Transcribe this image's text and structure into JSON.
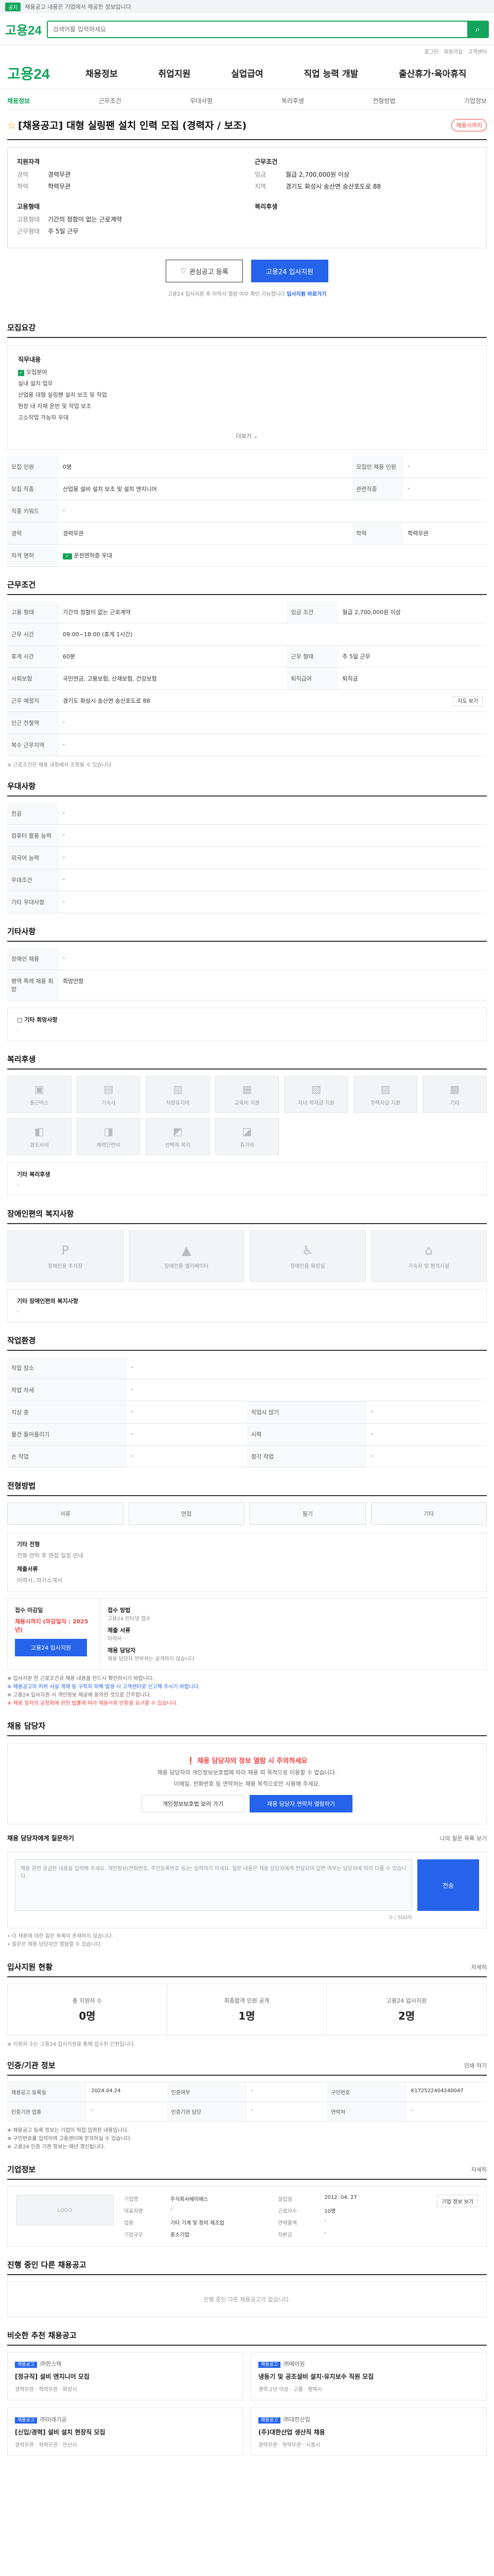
{
  "notice": {
    "tag": "공지",
    "text": "채용공고 내용은 기업에서 제공한 정보입니다"
  },
  "top": {
    "logo": "고용24",
    "search_placeholder": "검색어를 입력하세요"
  },
  "util": [
    "로그인",
    "회원가입",
    "고객센터"
  ],
  "gnb": {
    "logo": "고용24",
    "menu": [
      "채용정보",
      "취업지원",
      "실업급여",
      "직업 능력 개발",
      "출산휴가·육아휴직"
    ]
  },
  "sub_tabs": [
    "채용정보",
    "근무조건",
    "우대사항",
    "복리후생",
    "전형방법",
    "기업정보"
  ],
  "job": {
    "title": "[채용공고] 대형 실링팬 설치 인력 모집 (경력자 / 보조)",
    "pill": "채용시까지"
  },
  "summary": {
    "left_title": "지원자격",
    "left": [
      {
        "k": "경력",
        "v": "경력무관"
      },
      {
        "k": "학력",
        "v": "학력무관"
      }
    ],
    "emp_title": "고용형태",
    "emp": [
      {
        "k": "고용형태",
        "v": "기간의 정함이 없는 근로계약"
      },
      {
        "k": "근무형태",
        "v": "주 5일 근무"
      }
    ],
    "right_title": "근무조건",
    "right": [
      {
        "k": "임금",
        "v": "월급 2,700,000원 이상"
      },
      {
        "k": "지역",
        "v": "경기도 화성시 송산면 송산포도로 88"
      }
    ],
    "welfare_title": "복리후생"
  },
  "actions": {
    "scrap": "관심공고 등록",
    "apply": "고용24 입사지원"
  },
  "caution": {
    "text": "고용24 입사지원 후 이력서 열람 여부 확인 가능합니다",
    "link": "입사지원 바로가기"
  },
  "duty": {
    "head": "모집요강",
    "job_title": "직무내용",
    "checkbox": "모집분야",
    "lines": [
      "실내 설치 업무",
      "산업용 대형 실링팬 설치 보조 및 작업",
      "현장 내 자재 운반 및 작업 보조",
      "고소작업 가능자 우대"
    ],
    "more": "더보기"
  },
  "recruit_table": [
    {
      "k1": "모집 인원",
      "v1": "0명",
      "k2": "모집인 채용 인원",
      "v2": "-"
    },
    {
      "k1": "모집 직종",
      "v1": "산업용 설비 설치 보조 및 설치 엔지니어",
      "k2": "관련직종",
      "v2": "-"
    },
    {
      "k1": "직종 키워드",
      "v1": "-",
      "k2": "",
      "v2": ""
    },
    {
      "k1": "경력",
      "v1": "경력무관",
      "k2": "학력",
      "v2": "학력무관"
    },
    {
      "k1": "자격 면허",
      "v1": "운전면허증 우대",
      "k2": "",
      "v2": ""
    }
  ],
  "work": {
    "head": "근무조건",
    "rows": [
      {
        "k1": "고용 형태",
        "v1": "기간의 정함이 없는 근로계약",
        "k2": "임금 조건",
        "v2": "월급 2,700,000원 이상"
      },
      {
        "k1": "근무 시간",
        "v1": "09:00~18:00 (휴게 1시간)",
        "k2": "",
        "v2": ""
      },
      {
        "k1": "휴게 시간",
        "v1": "60분",
        "k2": "근무 형태",
        "v2": "주 5일 근무"
      },
      {
        "k1": "사회보험",
        "v1": "국민연금, 고용보험, 산재보험, 건강보험",
        "k2": "퇴직급여",
        "v2": "퇴직금"
      },
      {
        "k1": "근무 예정지",
        "v1": "경기도 화성시 송산면 송산포도로 88",
        "k2": "",
        "v2": ""
      },
      {
        "k1": "인근 전철역",
        "v1": "-",
        "k2": "",
        "v2": ""
      },
      {
        "k1": "복수 근무지역",
        "v1": "-",
        "k2": "",
        "v2": ""
      }
    ],
    "map_btn": "지도 보기",
    "note": "※ 근로조건은 채용 과정에서 조정될 수 있습니다"
  },
  "prefer": {
    "head": "우대사항",
    "rows": [
      {
        "k": "전공",
        "v": "-"
      },
      {
        "k": "컴퓨터 활용 능력",
        "v": "-"
      },
      {
        "k": "외국어 능력",
        "v": "-"
      },
      {
        "k": "우대조건",
        "v": "-"
      },
      {
        "k": "기타 우대사항",
        "v": "-"
      }
    ]
  },
  "etc": {
    "head": "기타사항",
    "rows": [
      {
        "k": "장애인 채용",
        "v": "-"
      },
      {
        "k": "병역 특례 채용 희망",
        "v": "희망안함"
      }
    ],
    "tag_title": "□ 기타 희망사항",
    "tag_value": "-"
  },
  "welfare": {
    "head": "복리후생",
    "icons": [
      {
        "name": "통근버스",
        "glyph": "▣"
      },
      {
        "name": "기숙사",
        "glyph": "▤"
      },
      {
        "name": "차량유지비",
        "glyph": "▥"
      },
      {
        "name": "교육비 지원",
        "glyph": "▦"
      },
      {
        "name": "자녀 학자금 지원",
        "glyph": "▧"
      },
      {
        "name": "주택자금 지원",
        "glyph": "▨"
      },
      {
        "name": "기타",
        "glyph": "▩"
      },
      {
        "name": "경조사비",
        "glyph": "◧"
      },
      {
        "name": "체력단련비",
        "glyph": "◨"
      },
      {
        "name": "선택적 복지",
        "glyph": "◩"
      },
      {
        "name": "휴가비",
        "glyph": "◪"
      }
    ],
    "tag_title": "기타 복리후생",
    "tag_value": "-"
  },
  "disabled": {
    "head": "장애인편의 복지사항",
    "cards": [
      {
        "name": "장애인용 주차장",
        "glyph": "P"
      },
      {
        "name": "장애인용 엘리베이터",
        "glyph": "▲"
      },
      {
        "name": "장애인용 화장실",
        "glyph": "♿"
      },
      {
        "name": "기숙사 및 편의시설",
        "glyph": "⌂"
      }
    ],
    "tag_title": "기타 장애인편의 복지사항",
    "tag_value": "-"
  },
  "env": {
    "head": "작업환경",
    "rows": [
      {
        "k1": "작업 장소",
        "v1": "-",
        "k2": "",
        "v2": ""
      },
      {
        "k1": "작업 자세",
        "v1": "-",
        "k2": "",
        "v2": ""
      },
      {
        "k1": "지상 층",
        "v1": "-",
        "k2": "작업시 앉기",
        "v2": "-"
      },
      {
        "k1": "물건 들어올리기",
        "v1": "-",
        "k2": "시력",
        "v2": "-"
      },
      {
        "k1": "손 작업",
        "v1": "-",
        "k2": "청각 작업",
        "v2": "-"
      }
    ]
  },
  "process": {
    "head": "전형방법",
    "steps": [
      "서류",
      "면접",
      "필기",
      "기타"
    ],
    "subtitle": "기타 전형",
    "subvalue": "전화 연락 후 면접 일정 안내",
    "doc_title": "제출서류",
    "doc_value": "이력서, 자기소개서"
  },
  "apply": {
    "l_title": "접수 마감일",
    "l_value": "채용시까지 (마감일자 : 2025년)",
    "l_btn": "고용24 입사지원",
    "r": [
      {
        "k": "접수 방법",
        "v": "고용24 인터넷 접수"
      },
      {
        "k": "제출 서류",
        "v": "이력서"
      },
      {
        "k": "채용 담당자",
        "v": "채용 담당자 연락처는 공개하지 않습니다"
      }
    ]
  },
  "warn": {
    "l1": "※ 입사지원 전 근로조건과 채용 내용을 반드시 확인하시기 바랍니다.",
    "l2": "※ 채용공고의 허위 사실 게재 등 구직자 피해 발생 시 고객센터로 신고해 주시기 바랍니다.",
    "l3": "※ 고용24 입사지원 시 개인정보 제공에 동의한 것으로 간주합니다.",
    "l4": "※ 채용 절차의 공정화에 관한 법률에 따라 채용서류 반환을 요구할 수 있습니다."
  },
  "qa": {
    "head": "채용 담당자",
    "title": "❗ 채용 담당자의 정보 열람 시 주의하세요",
    "p1": "채용 담당자의 개인정보보호법에 따라 채용 외 목적으로 이용할 수 없습니다.",
    "p2": "이메일, 전화번호 등 연락처는 채용 목적으로만 사용해 주세요.",
    "b1": "개인정보보호법 보러 가기",
    "b2": "채용 담당자 연락처 열람하기",
    "ask_title": "채용 담당자에게 질문하기",
    "ask_more": "나의 질문 목록 보기",
    "placeholder": "채용 관련 궁금한 내용을 입력해 주세요. 개인정보(전화번호, 주민등록번호 등)는 입력하지 마세요. 질문 내용은 채용 담당자에게 전달되며 답변 여부는 담당자에 따라 다를 수 있습니다.",
    "count": "0 / 500자",
    "submit": "전송",
    "foot1": "• 이 채용에 대한 질문 목록이 존재하지 않습니다.",
    "foot2": "• 질문은 채용 담당자만 열람할 수 있습니다."
  },
  "stats": {
    "head": "입사지원 현황",
    "more": "자세히",
    "items": [
      {
        "l": "총 지원자 수",
        "v": "0명"
      },
      {
        "l": "최종합격 인원 공개",
        "v": "1명"
      },
      {
        "l": "고용24 입사지원",
        "v": "2명"
      }
    ],
    "note": "※ 지원자 수는 고용24 입사지원을 통해 접수된 인원입니다."
  },
  "jobinfo": {
    "head": "인증/기관 정보",
    "print": "인쇄 하기",
    "rows": [
      {
        "k1": "채용공고 등록일",
        "v1": "2024.04.24",
        "k2": "인증여부",
        "v2": "-",
        "k3": "구인번호",
        "v3": "K172522404240047"
      },
      {
        "k1": "인증기관 업종",
        "v1": "-",
        "k2": "인증기관 담당",
        "v2": "-",
        "k3": "연락처",
        "v3": "-"
      }
    ],
    "n1": "※ 채용공고 등록 정보는 기업이 직접 입력한 내용입니다.",
    "n2": "※ 구인번호를 입력하여 고용센터에 문의하실 수 있습니다.",
    "n3": "※ 고용24 인증 기관 정보는 매년 갱신됩니다."
  },
  "company": {
    "head": "기업정보",
    "more": "자세히",
    "logo": "LOGO",
    "name_k": "기업명",
    "name_v": "주식회사에이에스",
    "ceo_k": "대표자명",
    "ceo_v": "-",
    "found_k": "설립일",
    "found_v": "2012. 04. 27",
    "type_k": "업종",
    "type_v": "기타 기계 및 장비 제조업",
    "staff_k": "근로자수",
    "staff_v": "10명",
    "sales_k": "연매출액",
    "sales_v": "-",
    "capital_k": "자본금",
    "capital_v": "-",
    "size_k": "기업규모",
    "size_v": "중소기업",
    "btn": "기업 정보 보기"
  },
  "recent": {
    "head": "진행 중인 다른 채용공고",
    "empty": "진행 중인 다른 채용공고가 없습니다."
  },
  "reco": {
    "head": "비슷한 추천 채용공고",
    "items": [
      {
        "tag": "채용공고",
        "co": "㈜한스텍",
        "title": "[정규직] 설비 엔지니어 모집",
        "meta": "경력무관 · 학력무관 · 화성시"
      },
      {
        "tag": "채용공고",
        "co": "㈜에이원",
        "title": "냉동기 및 공조설비 설치·유지보수 직원 모집",
        "meta": "경력 2년 이상 · 고졸 · 평택시"
      },
      {
        "tag": "채용공고",
        "co": "㈜미래기공",
        "title": "[신입/경력] 설비 설치 현장직 모집",
        "meta": "경력무관 · 학력무관 · 안산시"
      },
      {
        "tag": "채용공고",
        "co": "㈜대한산업",
        "title": "(주)대한산업 생산직 채용",
        "meta": "경력무관 · 학력무관 · 시흥시"
      }
    ]
  },
  "colors": {
    "brand": "#12a55b",
    "primary": "#2563eb",
    "danger": "#ef4444"
  }
}
